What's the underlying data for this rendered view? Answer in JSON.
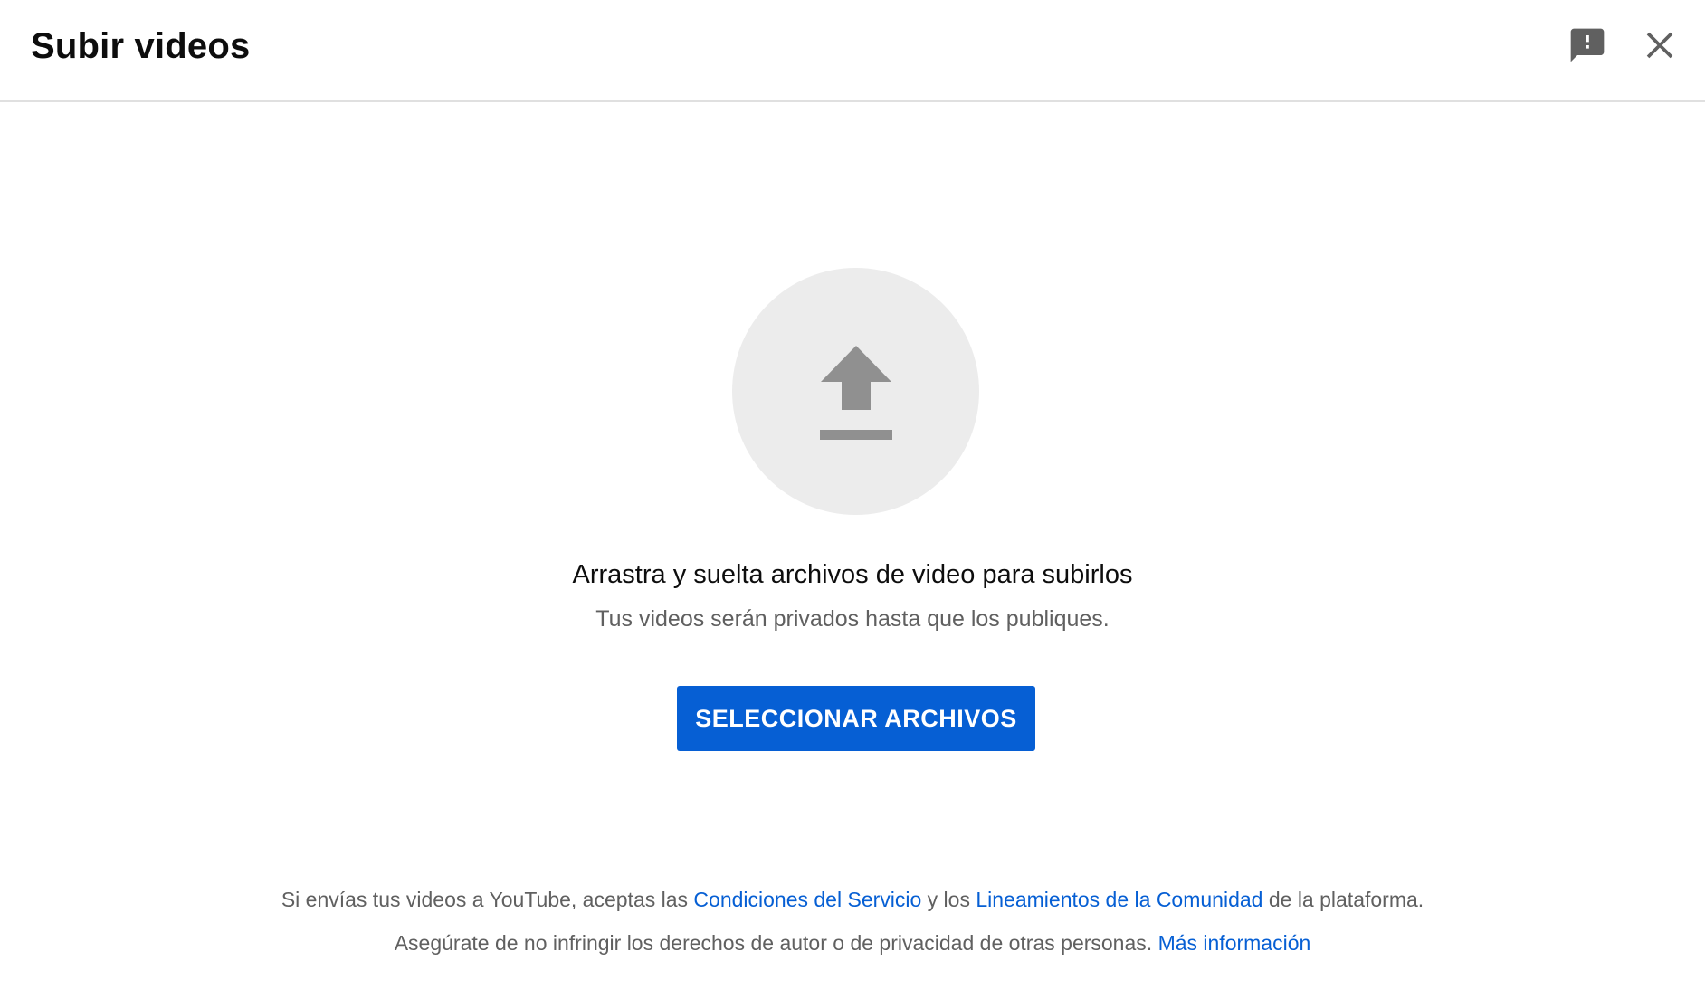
{
  "dialog": {
    "title": "Subir videos",
    "feedback_icon": "feedback-icon",
    "close_icon": "close-icon"
  },
  "upload": {
    "icon": "upload-icon",
    "drag_title": "Arrastra y suelta archivos de video para subirlos",
    "drag_subtitle": "Tus videos serán privados hasta que los publiques.",
    "select_button": "SELECCIONAR ARCHIVOS"
  },
  "footer": {
    "line1_prefix": "Si envías tus videos a YouTube, aceptas las ",
    "terms_link": "Condiciones del Servicio",
    "line1_middle": " y los ",
    "guidelines_link": "Lineamientos de la Comunidad",
    "line1_suffix": " de la plataforma.",
    "line2_prefix": "Asegúrate de no infringir los derechos de autor o de privacidad de otras personas. ",
    "learn_more_link": "Más información"
  },
  "colors": {
    "accent": "#065fd4",
    "icon_gray": "#909090",
    "circle_bg": "#ececec",
    "secondary_text": "#606060"
  }
}
